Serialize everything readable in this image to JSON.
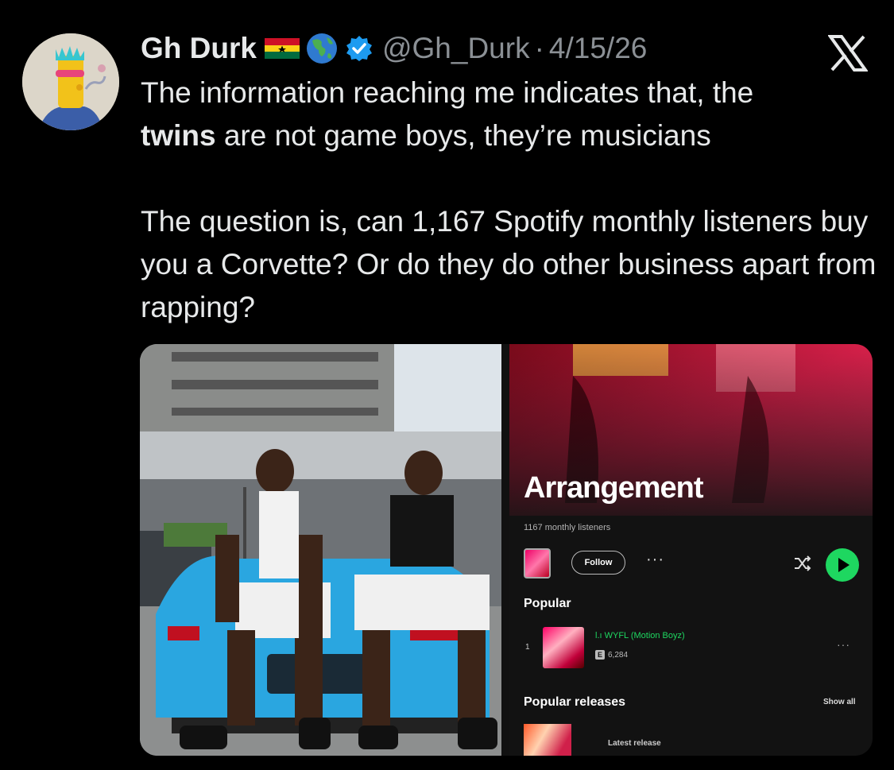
{
  "tweet": {
    "author_name": "Gh Durk",
    "handle": "@Gh_Durk",
    "separator": "·",
    "date": "4/15/26",
    "text_line_1": "The information reaching me indicates that, the",
    "text_bold": "twins",
    "text_line_2_rest": " are not game boys, they’re musicians",
    "text_para_2": "The question is, can 1,167 Spotify monthly listeners buy you a Corvette? Or do they do other business apart from rapping?"
  },
  "spotify": {
    "artist": "Arrangement",
    "monthly_listeners": "1167 monthly listeners",
    "follow_label": "Follow",
    "more_label": "···",
    "popular_label": "Popular",
    "track_number": "1",
    "track_title": "l.ı WYFL (Motion Boyz)",
    "track_explicit": "E",
    "track_plays": "6,284",
    "track_more": "···",
    "releases_label": "Popular releases",
    "show_all_label": "Show all",
    "latest_release_label": "Latest release",
    "accent_color": "#1ed760"
  },
  "icons": [
    "ghana-flag-icon",
    "globe-icon",
    "verified-badge-icon",
    "x-logo-icon",
    "shuffle-icon",
    "play-icon"
  ]
}
